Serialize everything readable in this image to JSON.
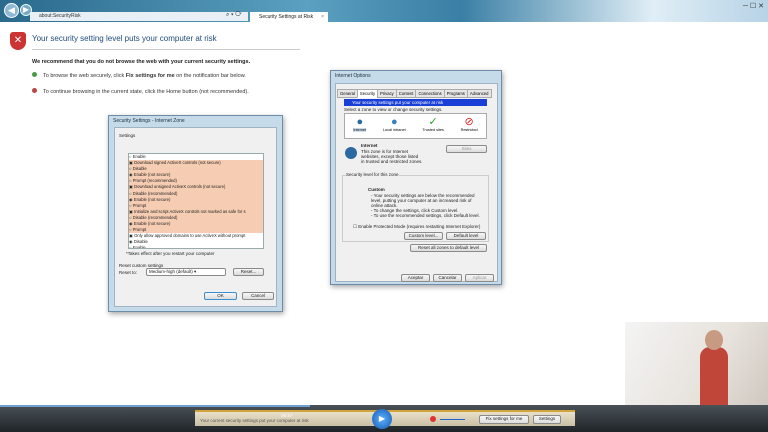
{
  "browser": {
    "address": "about:SecurityRisk",
    "tab_title": "Security Settings at Risk",
    "search_icons": "⌕ ▾ ⟳",
    "window_controls": "─ ☐ ✕"
  },
  "page": {
    "title": "Your security setting level puts your computer at risk",
    "recommendation": "We recommend that you do not browse the web with your current security settings.",
    "bullet1_pre": "To browse the web securely, click ",
    "bullet1_bold": "Fix settings for me",
    "bullet1_post": " on the notification bar below.",
    "bullet2": "To continue browsing in the current state, click the Home button (not recommended)."
  },
  "security_settings": {
    "title": "Security Settings - Internet Zone",
    "settings_label": "Settings",
    "rows": [
      {
        "t": "○ Enable",
        "hl": false
      },
      {
        "t": "▣ Download signed ActiveX controls (not secure)",
        "hl": true
      },
      {
        "t": "   ○ Disable",
        "hl": true
      },
      {
        "t": "   ◉ Enable (not secure)",
        "hl": true
      },
      {
        "t": "   ○ Prompt (recommended)",
        "hl": true
      },
      {
        "t": "▣ Download unsigned ActiveX controls (not secure)",
        "hl": true
      },
      {
        "t": "   ○ Disable (recommended)",
        "hl": true
      },
      {
        "t": "   ◉ Enable (not secure)",
        "hl": true
      },
      {
        "t": "   ○ Prompt",
        "hl": true
      },
      {
        "t": "▣ Initialize and script ActiveX controls not marked as safe for s",
        "hl": true
      },
      {
        "t": "   ○ Disable (recommended)",
        "hl": true
      },
      {
        "t": "   ◉ Enable (not secure)",
        "hl": true
      },
      {
        "t": "   ○ Prompt",
        "hl": true
      },
      {
        "t": "▣ Only allow approved domains to use ActiveX without prompt",
        "hl": false
      },
      {
        "t": "   ◉ Disable",
        "hl": false
      },
      {
        "t": "   ○ Enable",
        "hl": false
      }
    ],
    "note": "*Takes effect after you restart your computer",
    "reset_group": "Reset custom settings",
    "reset_to_label": "Reset to:",
    "reset_to_value": "Medium-high (default)",
    "reset_button": "Reset...",
    "ok": "OK",
    "cancel": "Cancel"
  },
  "internet_options": {
    "title": "Internet Options",
    "tabs": [
      "General",
      "Security",
      "Privacy",
      "Content",
      "Connections",
      "Programs",
      "Advanced"
    ],
    "warning": "Your security settings put your computer at risk",
    "select_zone": "Select a zone to view or change security settings.",
    "zones": [
      "Internet",
      "Local intranet",
      "Trusted sites",
      "Restricted"
    ],
    "zone_name": "Internet",
    "zone_desc": "This zone is for Internet websites, except those listed in trusted and restricted zones.",
    "sites": "Sites",
    "level_group": "Security level for this zone",
    "level_name": "Custom",
    "level_desc": [
      "- Your security settings are below the recommended level, putting your computer at an increased risk of online attack.",
      "- To change the settings, click Custom level.",
      "- To use the recommended settings, click Default level."
    ],
    "protected_mode": "Enable Protected Mode (requires restarting Internet Explorer)",
    "custom_level": "Custom level...",
    "default_level": "Default level",
    "reset_all": "Reset all zones to default level",
    "accept": "Aceptar",
    "cancel": "Cancelar",
    "apply": "Aplicar"
  },
  "player": {
    "time": "05:47",
    "notification": "Your current security settings put your computer at risk",
    "fix_button": "Fix settings for me",
    "settings_button": "Settings"
  }
}
